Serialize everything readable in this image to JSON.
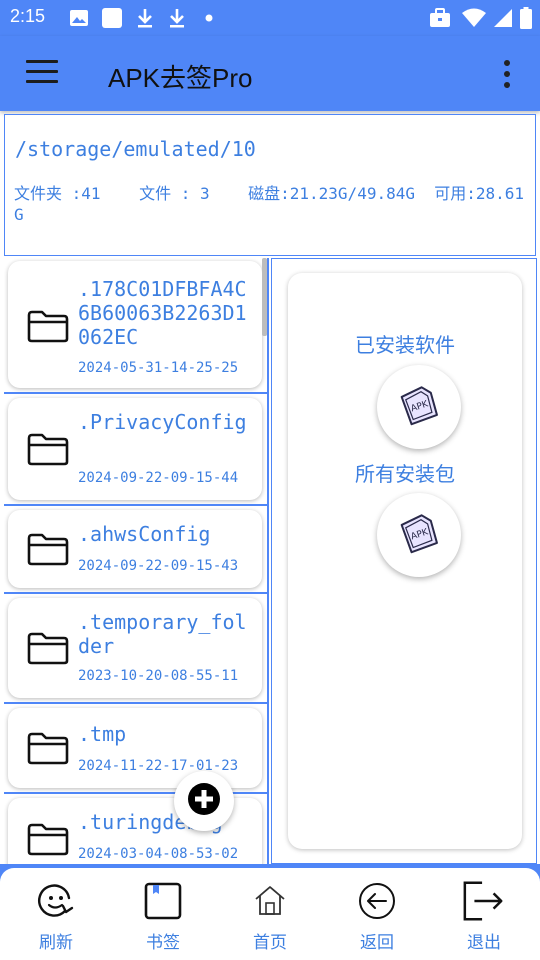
{
  "status_bar": {
    "time": "2:15",
    "icons": [
      "image-icon",
      "square-icon",
      "download-icon",
      "download-icon",
      "dot-icon",
      "briefcase-icon",
      "wifi-icon",
      "signal-icon",
      "battery-icon"
    ]
  },
  "app_bar": {
    "title": "APK去签Pro",
    "menu_icon": "hamburger-menu-icon",
    "more_icon": "more-vert-icon"
  },
  "path_panel": {
    "path": "/storage/emulated/10",
    "stats": "文件夹 :41    文件 : 3    磁盘:21.23G/49.84G  可用:28.61G"
  },
  "files": [
    {
      "name": ".178C01DFBFA4C6B60063B2263D1062EC",
      "date": "2024-05-31-14-25-25"
    },
    {
      "name": ".PrivacyConfig",
      "date": "2024-09-22-09-15-44"
    },
    {
      "name": ".ahwsConfig",
      "date": "2024-09-22-09-15-43"
    },
    {
      "name": ".temporary_folder",
      "date": "2023-10-20-08-55-11"
    },
    {
      "name": ".tmp",
      "date": "2024-11-22-17-01-23"
    },
    {
      "name": ".turingdebug",
      "date": "2024-03-04-08-53-02"
    }
  ],
  "right_panel": {
    "installed_label": "已安装软件",
    "packages_label": "所有安装包",
    "apk_icon_text": "APK"
  },
  "fab": {
    "icon": "add-circle-icon"
  },
  "bottom_nav": [
    {
      "label": "刷新",
      "icon": "refresh-icon"
    },
    {
      "label": "书签",
      "icon": "bookmark-icon"
    },
    {
      "label": "首页",
      "icon": "home-icon"
    },
    {
      "label": "返回",
      "icon": "back-arrow-icon"
    },
    {
      "label": "退出",
      "icon": "exit-icon"
    }
  ],
  "colors": {
    "primary": "#4f86f7",
    "text_blue": "#3d7fe0"
  }
}
